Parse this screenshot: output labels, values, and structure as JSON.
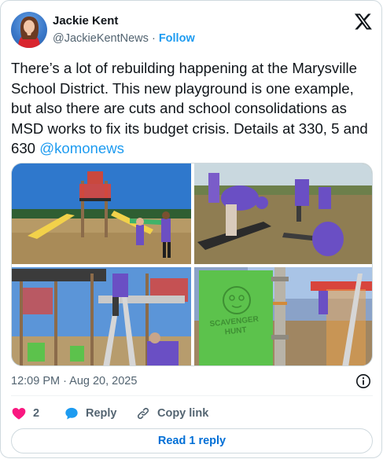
{
  "author": {
    "name": "Jackie Kent",
    "handle": "@JackieKentNews",
    "separator": "·",
    "follow_label": "Follow"
  },
  "tweet": {
    "text": "There’s a lot of rebuilding happening at the Marysville School District. This new playground is one example, but also there are cuts and school consolidations as MSD works to fix its budget crisis. Details at 330, 5 and 630 ",
    "mention": "@komonews"
  },
  "media": {
    "photos": [
      "playground-overview",
      "volunteers-assembling",
      "ladder-on-play-structure",
      "scavenger-hunt-panel"
    ],
    "panel_text": [
      "SCAVENGER",
      "HUNT"
    ]
  },
  "meta": {
    "timestamp": "12:09 PM · Aug 20, 2025"
  },
  "actions": {
    "like_count": "2",
    "reply_label": "Reply",
    "copy_label": "Copy link"
  },
  "read_reply_label": "Read 1 reply",
  "colors": {
    "accent": "#1d9bf0",
    "like": "#f91880",
    "text": "#0f1419",
    "muted": "#536471"
  }
}
